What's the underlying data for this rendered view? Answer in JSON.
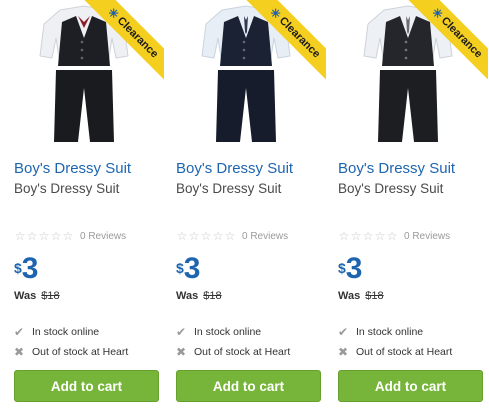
{
  "products": [
    {
      "title": "Boy's Dressy Suit",
      "subtitle": "Boy's Dressy Suit",
      "ribbon": "Clearance",
      "stars": 5,
      "reviews": "0 Reviews",
      "currency": "$",
      "price": "3",
      "was_label": "Was",
      "was_price": "$18",
      "stock_online": "In stock online",
      "stock_store": "Out of stock at Heart",
      "cart_label": "Add to cart"
    },
    {
      "title": "Boy's Dressy Suit",
      "subtitle": "Boy's Dressy Suit",
      "ribbon": "Clearance",
      "stars": 5,
      "reviews": "0 Reviews",
      "currency": "$",
      "price": "3",
      "was_label": "Was",
      "was_price": "$18",
      "stock_online": "In stock online",
      "stock_store": "Out of stock at Heart",
      "cart_label": "Add to cart"
    },
    {
      "title": "Boy's Dressy Suit",
      "subtitle": "Boy's Dressy Suit",
      "ribbon": "Clearance",
      "stars": 5,
      "reviews": "0 Reviews",
      "currency": "$",
      "price": "3",
      "was_label": "Was",
      "was_price": "$18",
      "stock_online": "In stock online",
      "stock_store": "Out of stock at Heart",
      "cart_label": "Add to cart"
    }
  ],
  "colors": {
    "link_blue": "#1e65b0",
    "ribbon_yellow": "#f5cf1f",
    "cart_green": "#77b53a"
  },
  "icons": {
    "star": "star-outline-icon",
    "stock_ok": "check-icon",
    "stock_no": "x-icon",
    "ribbon_mark": "spark-icon"
  }
}
